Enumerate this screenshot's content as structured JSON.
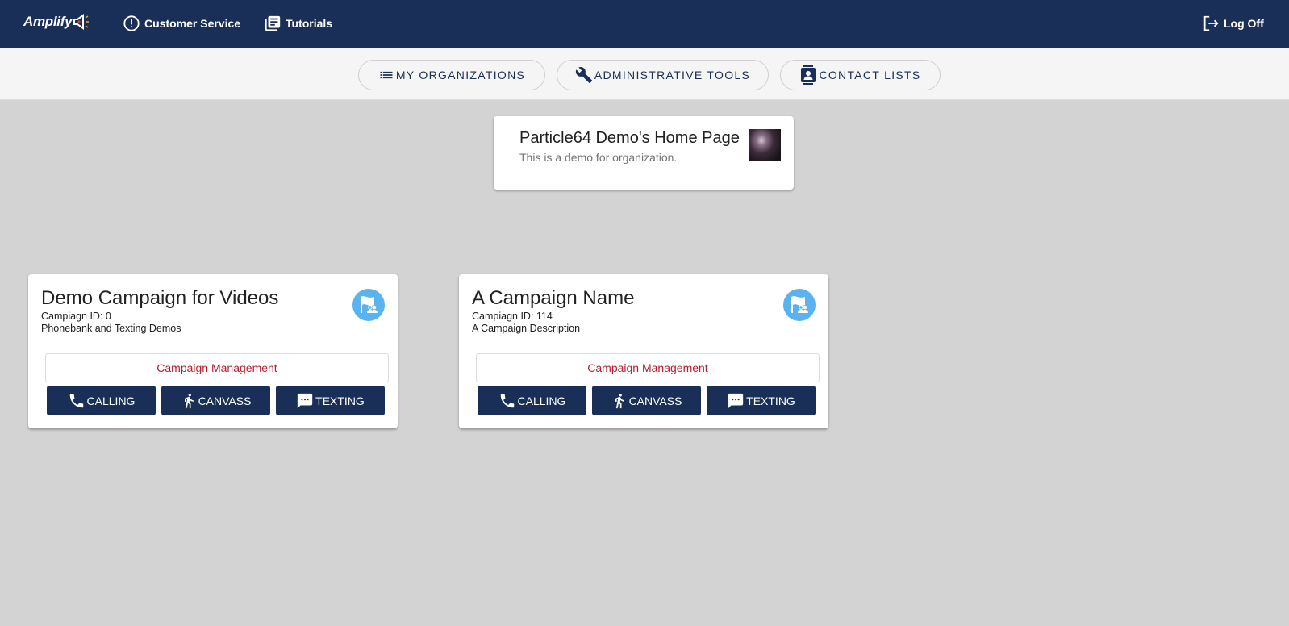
{
  "header": {
    "logo_text": "Amplify",
    "nav": [
      {
        "label": "Customer Service",
        "icon": "alert-circle-icon"
      },
      {
        "label": "Tutorials",
        "icon": "library-books-icon"
      }
    ],
    "logoff_label": "Log Off",
    "bg_color": "#1a2f57"
  },
  "subnav": {
    "items": [
      {
        "label": "MY ORGANIZATIONS",
        "icon": "list-icon"
      },
      {
        "label": "ADMINISTRATIVE TOOLS",
        "icon": "wrench-icon"
      },
      {
        "label": "CONTACT LISTS",
        "icon": "contact-book-icon"
      }
    ]
  },
  "organization": {
    "title": "Particle64 Demo's Home Page",
    "description": "This is a demo for organization."
  },
  "campaigns": [
    {
      "title": "Demo Campaign for Videos",
      "id_text": "Campiagn ID: 0",
      "description": "Phonebank and Texting Demos",
      "management_label": "Campaign Management",
      "actions": {
        "calling": "CALLING",
        "canvass": "CANVASS",
        "texting": "TEXTING"
      }
    },
    {
      "title": "A Campaign Name",
      "id_text": "Campiagn ID: 114",
      "description": "A Campaign Description",
      "management_label": "Campaign Management",
      "actions": {
        "calling": "CALLING",
        "canvass": "CANVASS",
        "texting": "TEXTING"
      }
    }
  ],
  "colors": {
    "primary": "#1a2f57",
    "accent_blue": "#5ab3ef",
    "management_text": "#b71c2c",
    "background": "#d3d3d3"
  }
}
